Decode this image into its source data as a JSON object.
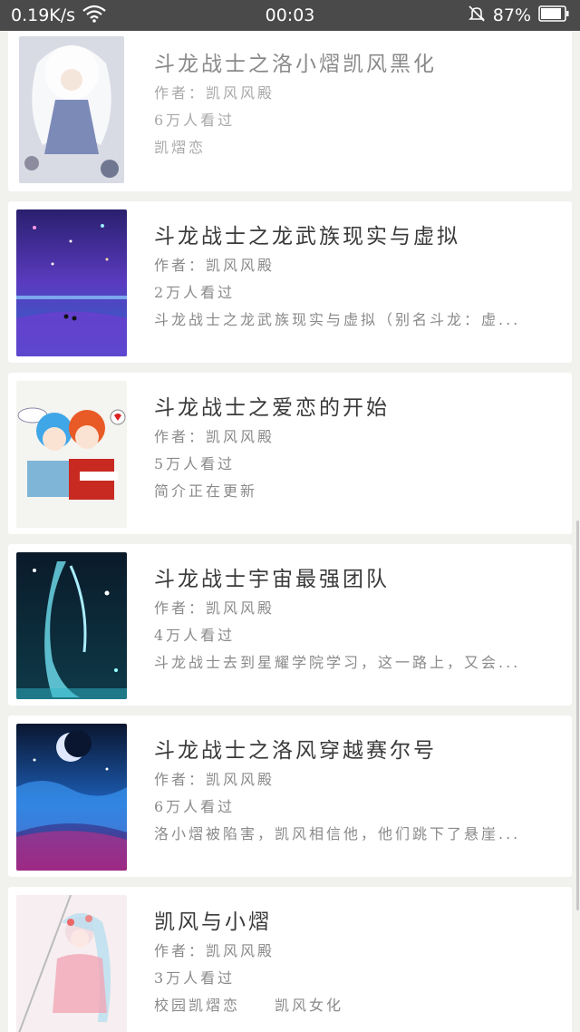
{
  "status_bar": {
    "speed": "0.19K/s",
    "time": "00:03",
    "battery": "87%",
    "icons": [
      "wifi-icon",
      "mute-bell-icon",
      "battery-icon"
    ]
  },
  "books": [
    {
      "title": "斗龙战士之洛小熠凯风黑化",
      "author_line": "作者：凯风风殿",
      "views": "6万人看过",
      "summary": "凯熠恋"
    },
    {
      "title": "斗龙战士之龙武族现实与虚拟",
      "author_line": "作者：凯风风殿",
      "views": "2万人看过",
      "summary": "斗龙战士之龙武族现实与虚拟（别名斗龙：虚..."
    },
    {
      "title": "斗龙战士之爱恋的开始",
      "author_line": "作者：凯风风殿",
      "views": "5万人看过",
      "summary": "简介正在更新"
    },
    {
      "title": "斗龙战士宇宙最强团队",
      "author_line": "作者：凯风风殿",
      "views": "4万人看过",
      "summary": "斗龙战士去到星耀学院学习，这一路上，又会..."
    },
    {
      "title": "斗龙战士之洛风穿越赛尔号",
      "author_line": "作者：凯风风殿",
      "views": "6万人看过",
      "summary": "洛小熠被陷害，凯风相信他，他们跳下了悬崖..."
    },
    {
      "title": "凯风与小熠",
      "author_line": "作者：凯风风殿",
      "views": "3万人看过",
      "summary": "校园凯熠恋　　凯风女化"
    }
  ]
}
